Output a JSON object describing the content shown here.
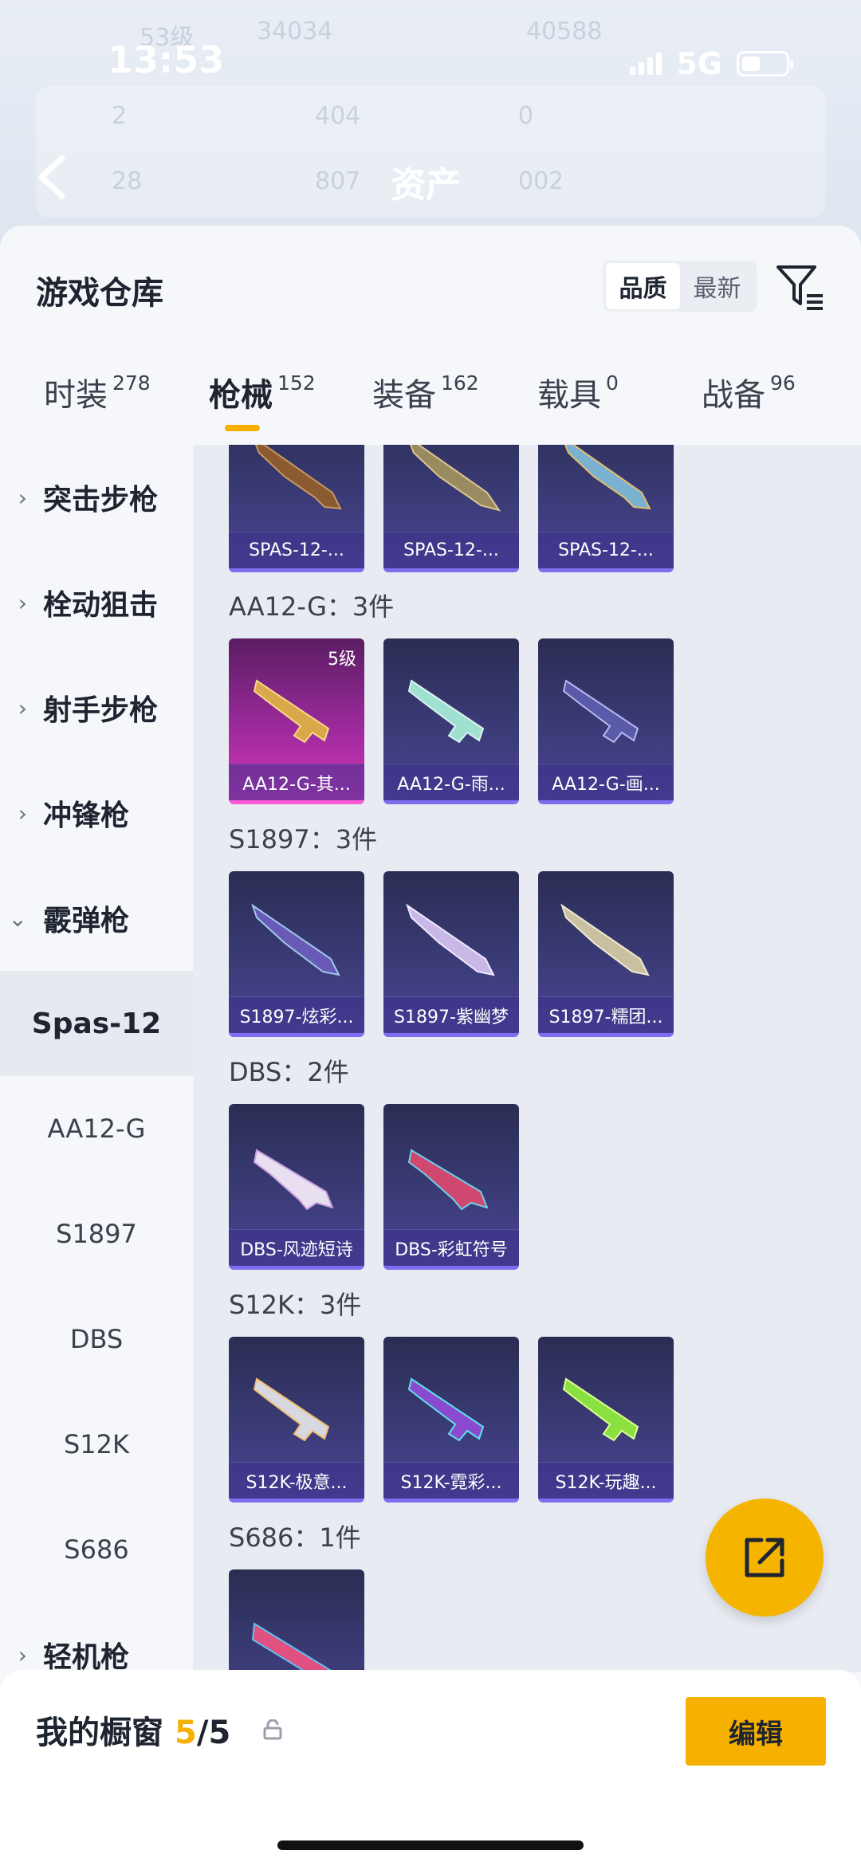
{
  "status_bar": {
    "time": "13:53",
    "network": "5G"
  },
  "header": {
    "title": "资产",
    "ghost_stats": [
      "53级",
      "34034",
      "40588",
      "2",
      "404",
      "0",
      "28",
      "807",
      "002"
    ]
  },
  "warehouse": {
    "title": "游戏仓库",
    "sort_options": [
      "品质",
      "最新"
    ],
    "sort_active": "品质"
  },
  "tabs": [
    {
      "label": "时装",
      "count": "278"
    },
    {
      "label": "枪械",
      "count": "152"
    },
    {
      "label": "装备",
      "count": "162"
    },
    {
      "label": "载具",
      "count": "0"
    },
    {
      "label": "战备",
      "count": "96"
    }
  ],
  "active_tab": "枪械",
  "sidebar": {
    "categories": [
      {
        "label": "突击步枪"
      },
      {
        "label": "栓动狙击"
      },
      {
        "label": "射手步枪"
      },
      {
        "label": "冲锋枪"
      },
      {
        "label": "霰弹枪"
      }
    ],
    "subcategories": [
      {
        "label": "Spas-12"
      },
      {
        "label": "AA12-G"
      },
      {
        "label": "S1897"
      },
      {
        "label": "DBS"
      },
      {
        "label": "S12K"
      },
      {
        "label": "S686"
      }
    ],
    "after": {
      "label": "轻机枪"
    }
  },
  "groups": [
    {
      "title": "",
      "items": [
        {
          "name": "SPAS-12-...",
          "level": ""
        },
        {
          "name": "SPAS-12-...",
          "level": ""
        },
        {
          "name": "SPAS-12-...",
          "level": ""
        }
      ]
    },
    {
      "title": "AA12-G：3件",
      "items": [
        {
          "name": "AA12-G-其...",
          "level": "5级"
        },
        {
          "name": "AA12-G-雨...",
          "level": ""
        },
        {
          "name": "AA12-G-画...",
          "level": ""
        }
      ]
    },
    {
      "title": "S1897：3件",
      "items": [
        {
          "name": "S1897-炫彩...",
          "level": ""
        },
        {
          "name": "S1897-紫幽梦",
          "level": ""
        },
        {
          "name": "S1897-糯团...",
          "level": ""
        }
      ]
    },
    {
      "title": "DBS：2件",
      "items": [
        {
          "name": "DBS-风迹短诗",
          "level": ""
        },
        {
          "name": "DBS-彩虹符号",
          "level": ""
        }
      ]
    },
    {
      "title": "S12K：3件",
      "items": [
        {
          "name": "S12K-极意...",
          "level": ""
        },
        {
          "name": "S12K-霓彩...",
          "level": ""
        },
        {
          "name": "S12K-玩趣...",
          "level": ""
        }
      ]
    },
    {
      "title": "S686：1件",
      "items": [
        {
          "name": "",
          "level": ""
        }
      ]
    }
  ],
  "showcase": {
    "label": "我的橱窗",
    "current": "5",
    "total": "/5",
    "edit_label": "编辑"
  }
}
